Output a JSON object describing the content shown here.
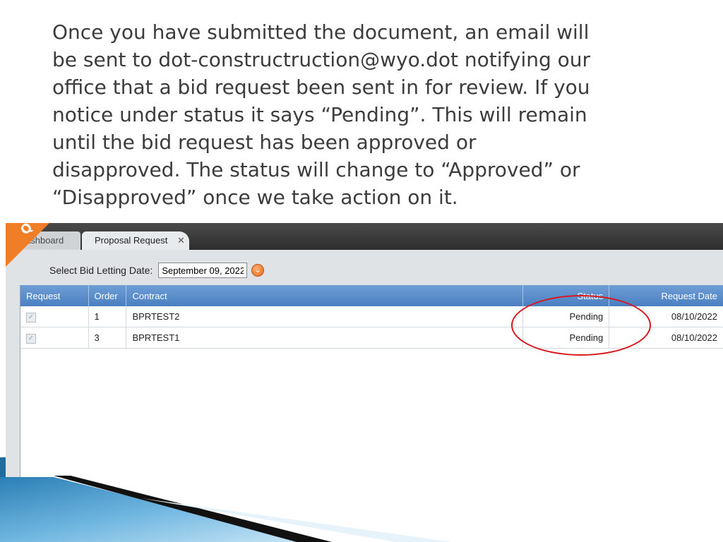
{
  "slide": {
    "lines": [
      "Once you have submitted the document, an email will",
      "be sent to dot-constructruction@wyo.dot notifying our",
      "office that a bid request been sent in for review.  If you",
      "notice under status it says “Pending”.  This will remain",
      "until the bid request has been approved or",
      "disapproved.  The status will change to “Approved” or",
      "“Disapproved” once we take action on it."
    ]
  },
  "app": {
    "tabs": [
      {
        "label": "ashboard"
      },
      {
        "label": "Proposal Request",
        "close": "✕"
      }
    ],
    "letting": {
      "label": "Select Bid Letting Date:",
      "value": "September 09, 2022"
    },
    "grid": {
      "headers": [
        "Request",
        "Order",
        "Contract",
        "Status",
        "Request Date"
      ],
      "rows": [
        {
          "order": "1",
          "contract": "BPRTEST2",
          "status": "Pending",
          "date": "08/10/2022"
        },
        {
          "order": "3",
          "contract": "BPRTEST1",
          "status": "Pending",
          "date": "08/10/2022"
        }
      ]
    }
  },
  "colors": {
    "accent": "#f07e26",
    "header_blue": "#4a7fc1",
    "highlight": "#d8161c"
  }
}
